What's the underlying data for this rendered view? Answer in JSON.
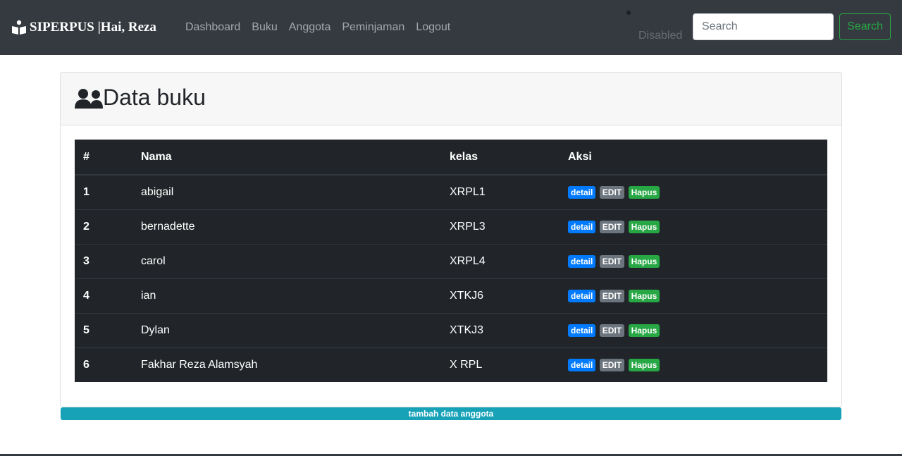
{
  "navbar": {
    "brand": "SIPERPUS |Hai, Reza",
    "links": [
      "Dashboard",
      "Buku",
      "Anggota",
      "Peminjaman",
      "Logout"
    ],
    "disabled_label": "Disabled",
    "search_placeholder": "Search",
    "search_button": "Search"
  },
  "page": {
    "title": "Data buku"
  },
  "table": {
    "headers": [
      "#",
      "Nama",
      "kelas",
      "Aksi"
    ],
    "rows": [
      {
        "no": "1",
        "nama": "abigail",
        "kelas": "XRPL1"
      },
      {
        "no": "2",
        "nama": "bernadette",
        "kelas": "XRPL3"
      },
      {
        "no": "3",
        "nama": "carol",
        "kelas": "XRPL4"
      },
      {
        "no": "4",
        "nama": "ian",
        "kelas": "XTKJ6"
      },
      {
        "no": "5",
        "nama": "Dylan",
        "kelas": "XTKJ3"
      },
      {
        "no": "6",
        "nama": "Fakhar Reza Alamsyah",
        "kelas": "X RPL"
      }
    ],
    "actions": {
      "detail": "detail",
      "edit": "EDIT",
      "hapus": "Hapus"
    }
  },
  "add_button": "tambah data anggota",
  "colors": {
    "navbar": "#343a40",
    "table_bg": "#212529",
    "detail": "#007bff",
    "edit": "#6c757d",
    "hapus": "#28a745",
    "add": "#17a2b8"
  },
  "icons": {
    "brand": "book-reader-icon",
    "title": "users-icon"
  }
}
